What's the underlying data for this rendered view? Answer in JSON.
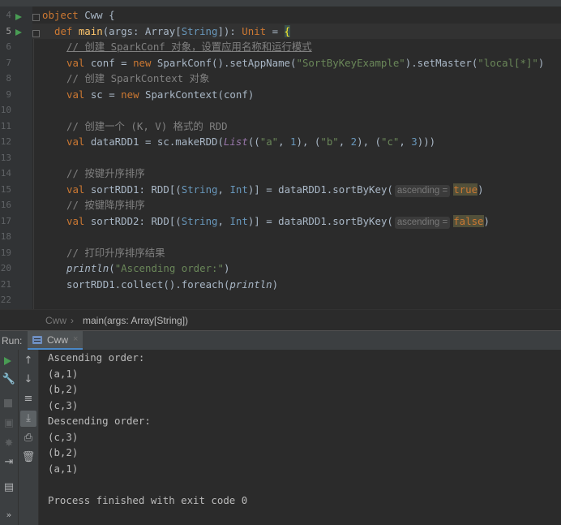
{
  "editor": {
    "current_line": "5",
    "line_numbers": [
      "4",
      "5",
      "6",
      "7",
      "8",
      "9",
      "10",
      "11",
      "12",
      "13",
      "14",
      "15",
      "16",
      "17",
      "18",
      "19",
      "20",
      "21",
      "22"
    ],
    "tokens": {
      "l4": [
        "object ",
        "Cww",
        " {"
      ],
      "l5": [
        "def ",
        "main",
        "(args: ",
        "Array",
        "[",
        "String",
        "]): ",
        "Unit",
        " = ",
        "{"
      ],
      "l6": [
        "// 创建 SparkConf 对象，设置应用名称和运行模式"
      ],
      "l7": [
        "val ",
        "conf = ",
        "new ",
        "SparkConf().setAppName(",
        "\"SortByKeyExample\"",
        ").setMaster(",
        "\"local[*]\"",
        ")"
      ],
      "l8": [
        "// 创建 SparkContext 对象"
      ],
      "l9": [
        "val ",
        "sc = ",
        "new ",
        "SparkContext(conf)"
      ],
      "l11": [
        "// 创建一个 (K, V) 格式的 RDD"
      ],
      "l12": [
        "val ",
        "dataRDD1 = sc.makeRDD(",
        "List",
        "((",
        "\"a\"",
        ", ",
        "1",
        "), (",
        "\"b\"",
        ", ",
        "2",
        "), (",
        "\"c\"",
        ", ",
        "3",
        ")))"
      ],
      "l14": [
        "// 按键升序排序"
      ],
      "l15": [
        "val ",
        "sortRDD1: RDD[(",
        "String",
        ", ",
        "Int",
        ")] = dataRDD1.sortByKey(",
        "ascending =",
        "true",
        ")"
      ],
      "l16": [
        "// 按键降序排序"
      ],
      "l17": [
        "val ",
        "sortRDD2: RDD[(",
        "String",
        ", ",
        "Int",
        ")] = dataRDD1.sortByKey(",
        "ascending =",
        "false",
        ")"
      ],
      "l19": [
        "// 打印升序排序结果"
      ],
      "l20": [
        "println",
        "(",
        "\"Ascending order:\"",
        ")"
      ],
      "l21": [
        "sortRDD1.collect().foreach(",
        "println",
        ")"
      ]
    }
  },
  "breadcrumb": {
    "object": "Cww",
    "separator": "›",
    "method": "main(args: Array[String])"
  },
  "run_panel": {
    "label": "Run:",
    "tab_name": "Cww",
    "tab_close": "×",
    "output": [
      "Ascending order:",
      "(a,1)",
      "(b,2)",
      "(c,3)",
      "Descending order:",
      "(c,3)",
      "(b,2)",
      "(a,1)",
      "",
      "Process finished with exit code 0"
    ]
  },
  "icons": {
    "rerun": "play-icon",
    "settings": "wrench-icon",
    "stop": "stop-icon",
    "scroll_up": "arrow-up-icon",
    "scroll_down": "arrow-down-icon",
    "soft_wrap": "soft-wrap-icon",
    "scroll_to_end": "scroll-to-end-icon",
    "print": "print-icon",
    "clear": "trash-icon",
    "camera": "camera-icon",
    "debug": "bug-icon",
    "exit": "exit-icon",
    "layout": "layout-icon",
    "more": "more-icon"
  },
  "icon_glyphs": {
    "more": "»"
  },
  "colors": {
    "background": "#2b2b2b",
    "keyword": "#cc7832",
    "string": "#6a8759",
    "number": "#6897bb",
    "comment": "#808080",
    "run_green": "#499c54",
    "tab_accent": "#4a88c7"
  }
}
